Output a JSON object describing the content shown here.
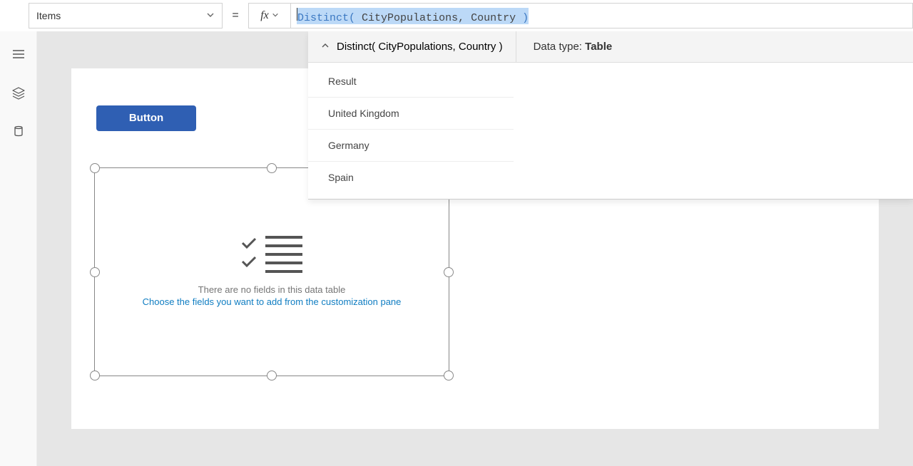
{
  "topBar": {
    "propertyName": "Items",
    "equals": "=",
    "fxLabel": "fx",
    "formula": {
      "fn": "Distinct",
      "open": "(",
      "arg1": "CityPopulations",
      "comma": ",",
      "arg2": "Country",
      "close": ")"
    }
  },
  "suggestion": {
    "expr": "Distinct( CityPopulations, Country )",
    "dataTypeLabel": "Data type: ",
    "dataTypeValue": "Table",
    "headerLabel": "Result",
    "rows": [
      "United Kingdom",
      "Germany",
      "Spain"
    ]
  },
  "canvas": {
    "buttonLabel": "Button",
    "emptyLine1": "There are no fields in this data table",
    "emptyLine2": "Choose the fields you want to add from the customization pane"
  }
}
